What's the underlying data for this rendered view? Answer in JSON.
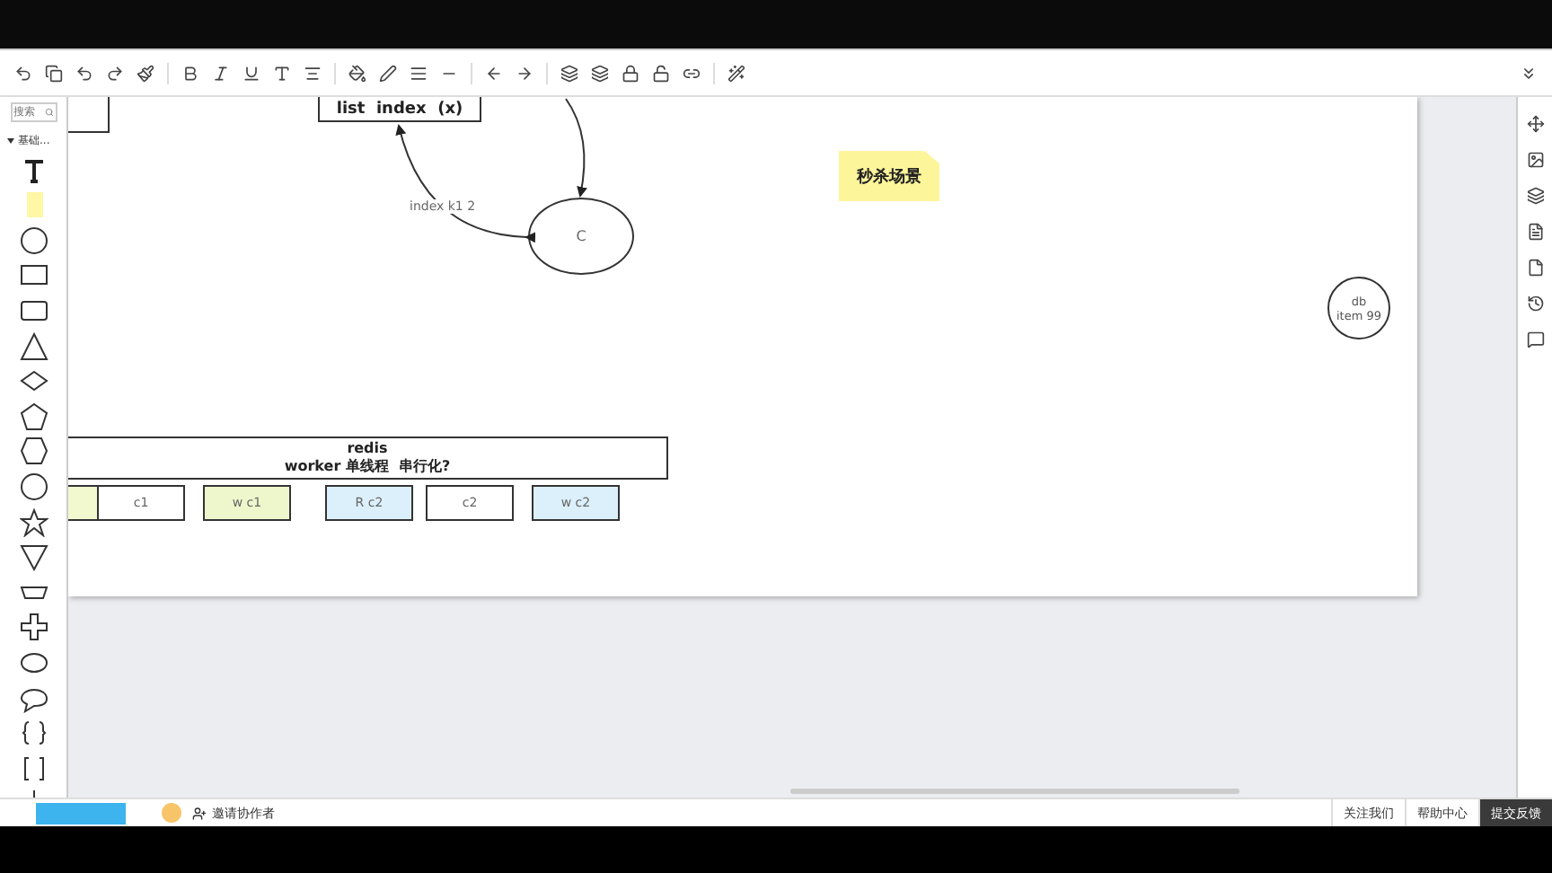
{
  "sidebar": {
    "search_placeholder": "搜索",
    "section": "基础..."
  },
  "diagram": {
    "list_box": "list  index  (x)",
    "ellipse": "C",
    "edge_label": "index k1 2",
    "note": "秒杀场景",
    "db": [
      "db",
      "item 99"
    ],
    "redis": [
      "redis",
      "worker 单线程  串行化?"
    ],
    "cells": [
      {
        "color": "#f2f9cf"
      },
      {
        "label": "c1",
        "color": "#ffffff"
      },
      {
        "label": "w c1",
        "color": "#eef7cc"
      },
      {
        "label": "R  c2",
        "color": "#dcf0fb"
      },
      {
        "label": "c2",
        "color": "#ffffff"
      },
      {
        "label": "w c2",
        "color": "#dcf0fb"
      }
    ]
  },
  "footer": {
    "invite": "邀请协作者",
    "links": [
      "关注我们",
      "帮助中心",
      "提交反馈"
    ]
  }
}
